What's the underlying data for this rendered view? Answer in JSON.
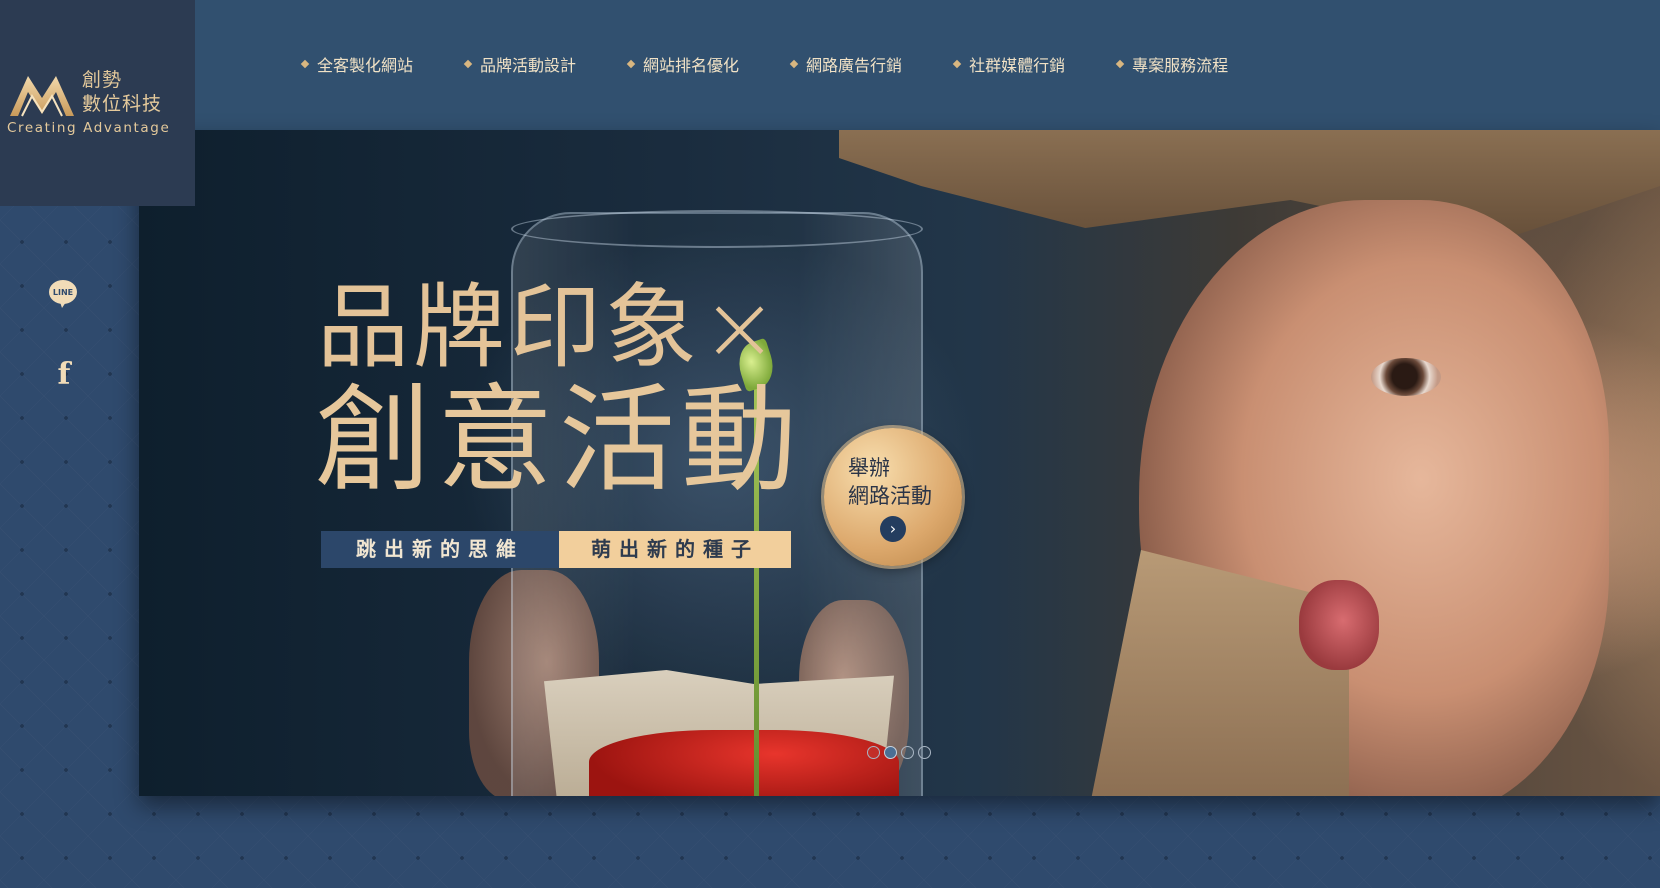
{
  "brand": {
    "name_line1": "創勢",
    "name_line2": "數位科技",
    "tagline": "Creating  Advantage"
  },
  "nav": {
    "items": [
      {
        "label": "全客製化網站"
      },
      {
        "label": "品牌活動設計"
      },
      {
        "label": "網站排名優化"
      },
      {
        "label": "網路廣告行銷"
      },
      {
        "label": "社群媒體行銷"
      },
      {
        "label": "專案服務流程"
      }
    ]
  },
  "social": {
    "line_label": "LINE",
    "facebook_glyph": "f"
  },
  "hero": {
    "headline_line1": "品牌印象×",
    "headline_line2": "創意活動",
    "tag1": "跳出新的思維",
    "tag2": "萌出新的種子",
    "cta_line1": "舉辦",
    "cta_line2": "網路活動",
    "cta_arrow": "›",
    "slide_count": 4,
    "active_slide": 2
  },
  "colors": {
    "accent_gold": "#e3c398",
    "nav_bg": "#31506f",
    "logo_bg": "#2c3b52",
    "tag_navy": "#2c476a",
    "tag_peach": "#f2cf9c"
  }
}
